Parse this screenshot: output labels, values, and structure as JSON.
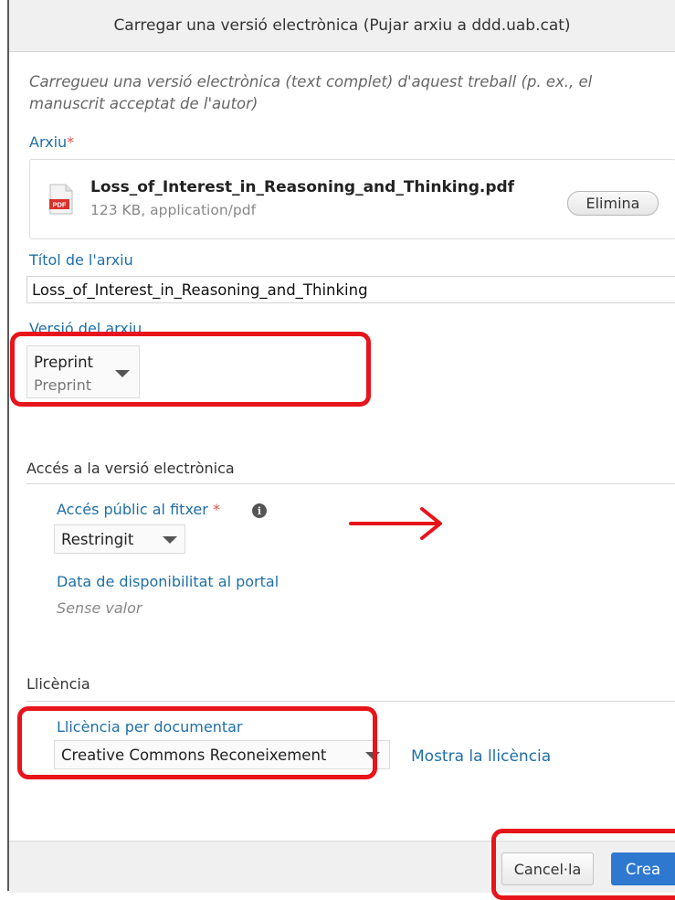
{
  "dialog": {
    "title": "Carregar una versió electrònica (Pujar arxiu a ddd.uab.cat)",
    "intro": "Carregueu una versió electrònica (text complet) d'aquest treball (p. ex., el manuscrit acceptat de l'autor)"
  },
  "file": {
    "label": "Arxiu",
    "required_mark": "*",
    "icon_text": "PDF",
    "name": "Loss_of_Interest_in_Reasoning_and_Thinking.pdf",
    "meta": "123 KB, application/pdf",
    "remove_label": "Elimina"
  },
  "file_title": {
    "label": "Títol de l'arxiu",
    "value": "Loss_of_Interest_in_Reasoning_and_Thinking"
  },
  "file_version": {
    "label": "Versió del arxiu",
    "selected": "Preprint",
    "selected_sub": "Preprint"
  },
  "access": {
    "heading": "Accés a la versió electrònica",
    "public_label": "Accés públic al fitxer",
    "required_mark": "*",
    "info_icon": "i",
    "public_value": "Restringit",
    "availability_label": "Data de disponibilitat al portal",
    "availability_value": "Sense valor"
  },
  "license": {
    "heading": "Llicència",
    "label": "Llicència per documentar",
    "value": "Creative Commons Reconeixement",
    "show_link": "Mostra la llicència"
  },
  "footer": {
    "cancel_label": "Cancel·la",
    "create_label": "Crea"
  },
  "colors": {
    "annotation": "#e8141b",
    "link": "#1f6fa8",
    "primary_button": "#2e78d0"
  }
}
